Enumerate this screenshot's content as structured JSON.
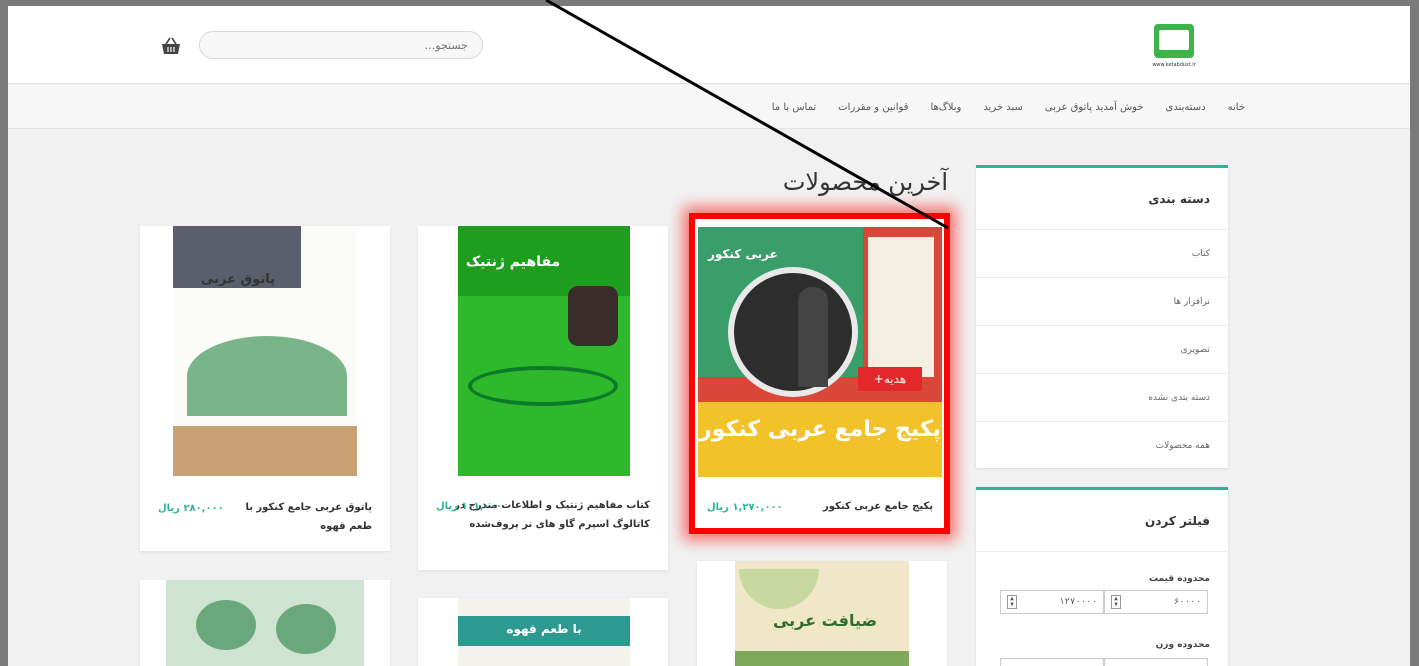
{
  "header": {
    "logo_text": "www.ketabdust.ir",
    "search_placeholder": "جستجو..."
  },
  "nav": {
    "items": [
      "خانه",
      "دسته‌بندی",
      "خوش آمدید پاتوق عربی",
      "سبد خرید",
      "وبلاگ‌ها",
      "قوانین و مقررات",
      "تماس با ما"
    ]
  },
  "main": {
    "section_title": "آخرین محصولات",
    "products": [
      {
        "name": "پکیج جامع عربی کنکور",
        "price": "۱,۲۷۰,۰۰۰ ریال",
        "cover_title": "پکیج جامع عربی کنکور",
        "cover_badge": "+هدیه",
        "cover_book": "عربی کنکور"
      },
      {
        "name": "کتاب مفاهیم ژنتیک و اطلاعات مندرج در کاتالوگ اسپرم گاو های نر پروف‌شده",
        "price": "۱۰۱,۰۰۰ ریال",
        "cover_title": "مفاهیم ژنتیک"
      },
      {
        "name": "پاتوق عربی جامع کنکور با طعم قهوه",
        "price": "۲۸۰,۰۰۰ ریال",
        "cover_title": "پاتوق عربی"
      },
      {
        "cover_title": "ضیافت عربی"
      },
      {
        "cover_title": "با طعم قهوه"
      }
    ]
  },
  "sidebar": {
    "categories_title": "دسته بندی",
    "categories": [
      "کتاب",
      "نرافزار ها",
      "تصویری",
      "دسته بندی نشده",
      "همه محصولات"
    ],
    "filter_title": "فیلتر کردن",
    "price_range_label": "محدوده قیمت",
    "price_min": "۶۰۰۰۰",
    "price_max": "۱۲۷۰۰۰۰",
    "weight_range_label": "محدوده وزن"
  },
  "colors": {
    "accent": "#2cb49a",
    "highlight": "#ff0000"
  }
}
